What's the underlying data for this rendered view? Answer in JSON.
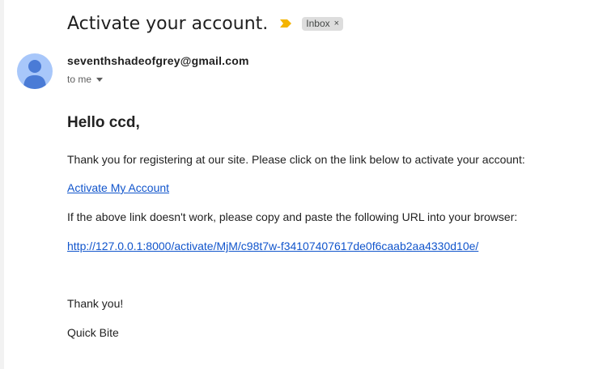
{
  "email": {
    "subject": "Activate your account.",
    "label": "Inbox",
    "label_remove": "×",
    "sender": "seventhshadeofgrey@gmail.com",
    "recipient": "to me",
    "greeting": "Hello ccd,",
    "intro": "Thank you for registering at our site. Please click on the link below to activate your account:",
    "activate_link": "Activate My Account",
    "fallback_text": "If the above link doesn't work, please copy and paste the following URL into your browser:",
    "activation_url": "http://127.0.0.1:8000/activate/MjM/c98t7w-f34107407617de0f6caab2aa4330d10e/",
    "thanks": "Thank you!",
    "signature": "Quick Bite"
  },
  "icons": {
    "importance": "importance-marker-icon",
    "avatar": "person-avatar-icon",
    "dropdown": "chevron-down-icon"
  },
  "colors": {
    "importance": "#f4b400",
    "avatar_bg": "#a8c7fa",
    "avatar_fg": "#4a7bd6",
    "link": "#1155cc",
    "chip_bg": "#dddddd"
  }
}
